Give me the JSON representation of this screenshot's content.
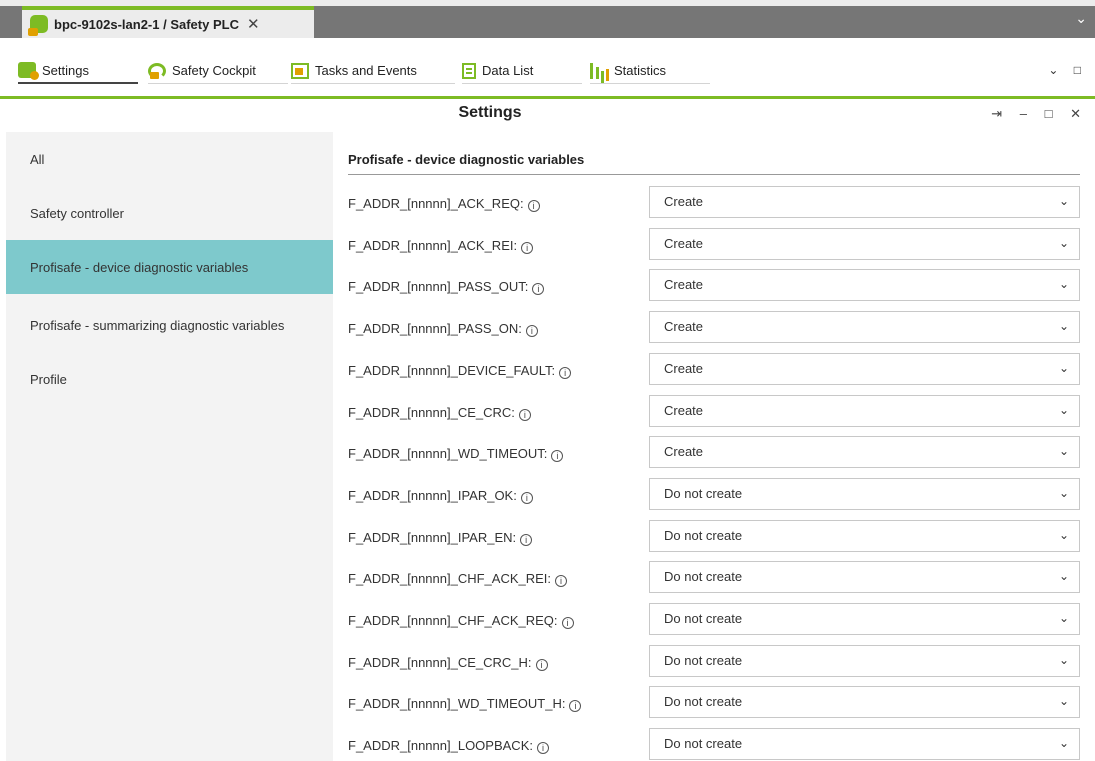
{
  "window": {
    "tab_title": "bpc-9102s-lan2-1 / Safety PLC",
    "tab_close": "✕",
    "menu_chevron": "⌄"
  },
  "toolbar": {
    "items": [
      {
        "label": "Settings",
        "icon": "settings-icon"
      },
      {
        "label": "Safety Cockpit",
        "icon": "cockpit-icon"
      },
      {
        "label": "Tasks and Events",
        "icon": "tasks-icon"
      },
      {
        "label": "Data List",
        "icon": "data-list-icon"
      },
      {
        "label": "Statistics",
        "icon": "statistics-icon"
      }
    ],
    "right_chevron": "⌄",
    "right_restore": "□"
  },
  "panel": {
    "title": "Settings",
    "pin": "⇥",
    "minimize": "–",
    "maximize": "□",
    "close": "✕"
  },
  "sidebar": {
    "items": [
      {
        "label": "All"
      },
      {
        "label": "Safety controller"
      },
      {
        "label": "Profisafe - device diagnostic variables",
        "selected": true
      },
      {
        "label": "Profisafe - summarizing diagnostic variables"
      },
      {
        "label": "Profile"
      }
    ]
  },
  "main": {
    "section_title": "Profisafe - device diagnostic variables",
    "info_glyph": "i",
    "chevron": "⌄",
    "rows": [
      {
        "label": "F_ADDR_[nnnnn]_ACK_REQ:",
        "value": "Create"
      },
      {
        "label": "F_ADDR_[nnnnn]_ACK_REI:",
        "value": "Create"
      },
      {
        "label": "F_ADDR_[nnnnn]_PASS_OUT:",
        "value": "Create"
      },
      {
        "label": "F_ADDR_[nnnnn]_PASS_ON:",
        "value": "Create"
      },
      {
        "label": "F_ADDR_[nnnnn]_DEVICE_FAULT:",
        "value": "Create"
      },
      {
        "label": "F_ADDR_[nnnnn]_CE_CRC:",
        "value": "Create"
      },
      {
        "label": "F_ADDR_[nnnnn]_WD_TIMEOUT:",
        "value": "Create"
      },
      {
        "label": "F_ADDR_[nnnnn]_IPAR_OK:",
        "value": "Do not create"
      },
      {
        "label": "F_ADDR_[nnnnn]_IPAR_EN:",
        "value": "Do not create"
      },
      {
        "label": "F_ADDR_[nnnnn]_CHF_ACK_REI:",
        "value": "Do not create"
      },
      {
        "label": "F_ADDR_[nnnnn]_CHF_ACK_REQ:",
        "value": "Do not create"
      },
      {
        "label": "F_ADDR_[nnnnn]_CE_CRC_H:",
        "value": "Do not create"
      },
      {
        "label": "F_ADDR_[nnnnn]_WD_TIMEOUT_H:",
        "value": "Do not create"
      },
      {
        "label": "F_ADDR_[nnnnn]_LOOPBACK:",
        "value": "Do not create"
      }
    ]
  }
}
